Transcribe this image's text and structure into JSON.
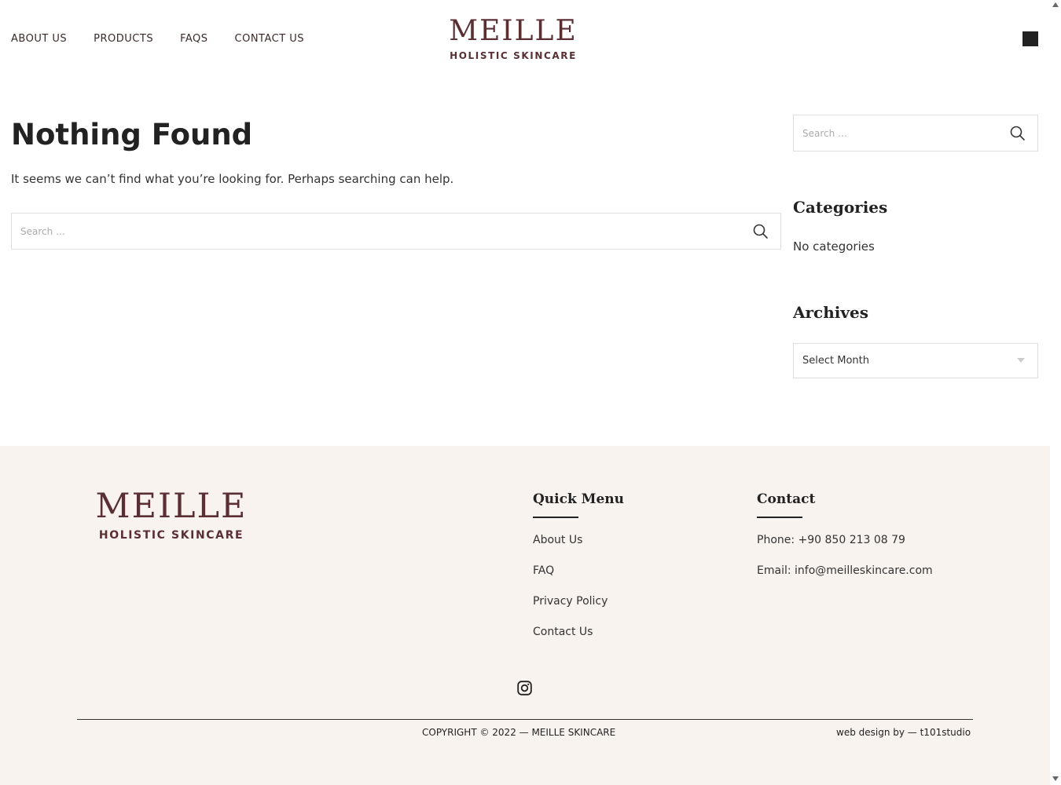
{
  "header": {
    "nav": [
      "ABOUT US",
      "PRODUCTS",
      "FAQS",
      "CONTACT US"
    ],
    "logo": {
      "brand": "MEILLE",
      "tagline": "HOLISTIC SKINCARE"
    }
  },
  "main": {
    "title": "Nothing Found",
    "message": "It seems we can’t find what you’re looking for. Perhaps searching can help.",
    "search_placeholder": "Search …"
  },
  "sidebar": {
    "search_placeholder": "Search …",
    "categories_title": "Categories",
    "categories_empty": "No categories",
    "archives_title": "Archives",
    "archives_select": "Select Month"
  },
  "footer": {
    "logo": {
      "brand": "MEILLE",
      "tagline": "HOLISTIC SKINCARE"
    },
    "quick_menu_title": "Quick Menu",
    "quick_menu": [
      "About Us",
      "FAQ",
      "Privacy Policy",
      "Contact Us"
    ],
    "contact_title": "Contact",
    "phone": "Phone: +90 850 213 08 79",
    "email": "Email: info@meilleskincare.com",
    "copyright": "COPYRIGHT © 2022 — MEILLE SKINCARE",
    "credit": "web design by — t101studio"
  },
  "colors": {
    "brand": "#5a2f34",
    "footer_bg": "#f9f3ef"
  },
  "icons": {
    "search": "search-icon",
    "instagram": "instagram-icon",
    "cart": "cart-icon"
  }
}
